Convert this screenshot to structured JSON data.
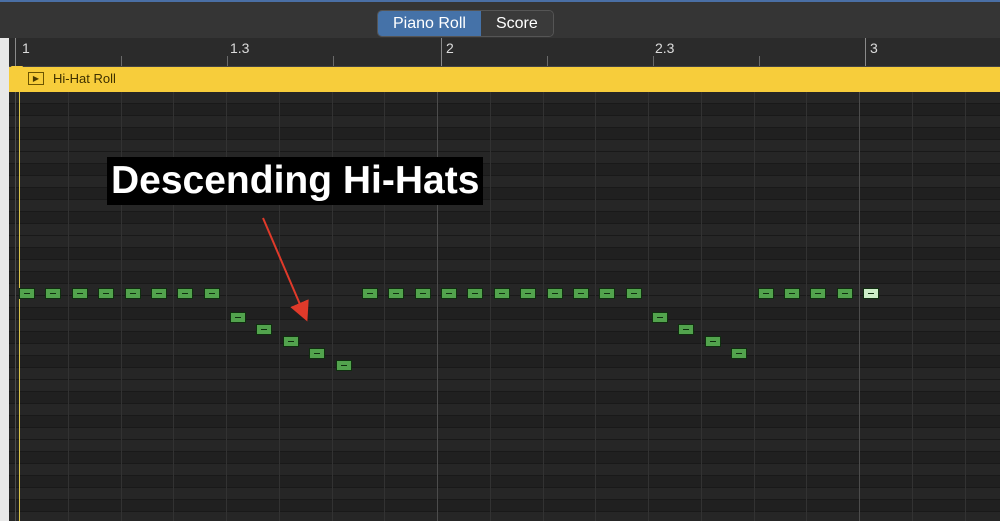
{
  "tabs": [
    {
      "label": "Piano Roll",
      "active": true
    },
    {
      "label": "Score",
      "active": false
    }
  ],
  "ruler": {
    "labels": [
      "1",
      "1.3",
      "2",
      "2.3",
      "3"
    ]
  },
  "region": {
    "name": "Hi-Hat Roll",
    "color": "#f7cd3b"
  },
  "annotation": {
    "text": "Descending Hi-Hats",
    "arrow_color": "#e03a2a"
  },
  "notes": {
    "color": "#52a34d",
    "step_beats": 0.125,
    "events": [
      {
        "beat": 0.0,
        "row": 0
      },
      {
        "beat": 0.125,
        "row": 0
      },
      {
        "beat": 0.25,
        "row": 0
      },
      {
        "beat": 0.375,
        "row": 0
      },
      {
        "beat": 0.5,
        "row": 0
      },
      {
        "beat": 0.625,
        "row": 0
      },
      {
        "beat": 0.75,
        "row": 0
      },
      {
        "beat": 0.875,
        "row": 0
      },
      {
        "beat": 1.0,
        "row": 2
      },
      {
        "beat": 1.125,
        "row": 3
      },
      {
        "beat": 1.25,
        "row": 4
      },
      {
        "beat": 1.375,
        "row": 5
      },
      {
        "beat": 1.5,
        "row": 6
      },
      {
        "beat": 1.625,
        "row": 0
      },
      {
        "beat": 1.75,
        "row": 0
      },
      {
        "beat": 1.875,
        "row": 0
      },
      {
        "beat": 2.0,
        "row": 0
      },
      {
        "beat": 2.125,
        "row": 0
      },
      {
        "beat": 2.25,
        "row": 0
      },
      {
        "beat": 2.375,
        "row": 0
      },
      {
        "beat": 2.5,
        "row": 0
      },
      {
        "beat": 2.625,
        "row": 0
      },
      {
        "beat": 2.75,
        "row": 0
      },
      {
        "beat": 2.875,
        "row": 0
      },
      {
        "beat": 3.0,
        "row": 2
      },
      {
        "beat": 3.125,
        "row": 3
      },
      {
        "beat": 3.25,
        "row": 4
      },
      {
        "beat": 3.375,
        "row": 5
      },
      {
        "beat": 3.5,
        "row": 0
      },
      {
        "beat": 3.625,
        "row": 0
      },
      {
        "beat": 3.75,
        "row": 0
      },
      {
        "beat": 3.875,
        "row": 0
      },
      {
        "beat": 4.0,
        "row": 0,
        "selected": true
      }
    ]
  }
}
